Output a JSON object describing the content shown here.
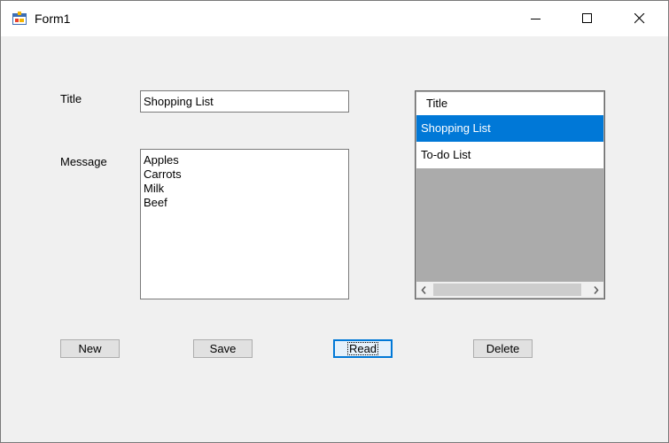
{
  "window": {
    "title": "Form1",
    "icon": "winforms-app-icon"
  },
  "caption_buttons": {
    "minimize": "minimize-icon",
    "maximize": "maximize-icon",
    "close": "close-icon"
  },
  "form": {
    "title_label": "Title",
    "title_value": "Shopping List",
    "message_label": "Message",
    "message_lines": [
      "Apples",
      "Carrots",
      "Milk",
      "Beef"
    ]
  },
  "listview": {
    "column_header": "Title",
    "items": [
      {
        "label": "Shopping List",
        "selected": true
      },
      {
        "label": "To-do List",
        "selected": false
      }
    ]
  },
  "buttons": {
    "new": "New",
    "save": "Save",
    "read": "Read",
    "delete": "Delete"
  },
  "colors": {
    "selection": "#0078d7",
    "form_background": "#f0f0f0",
    "list_background": "#ababab"
  }
}
